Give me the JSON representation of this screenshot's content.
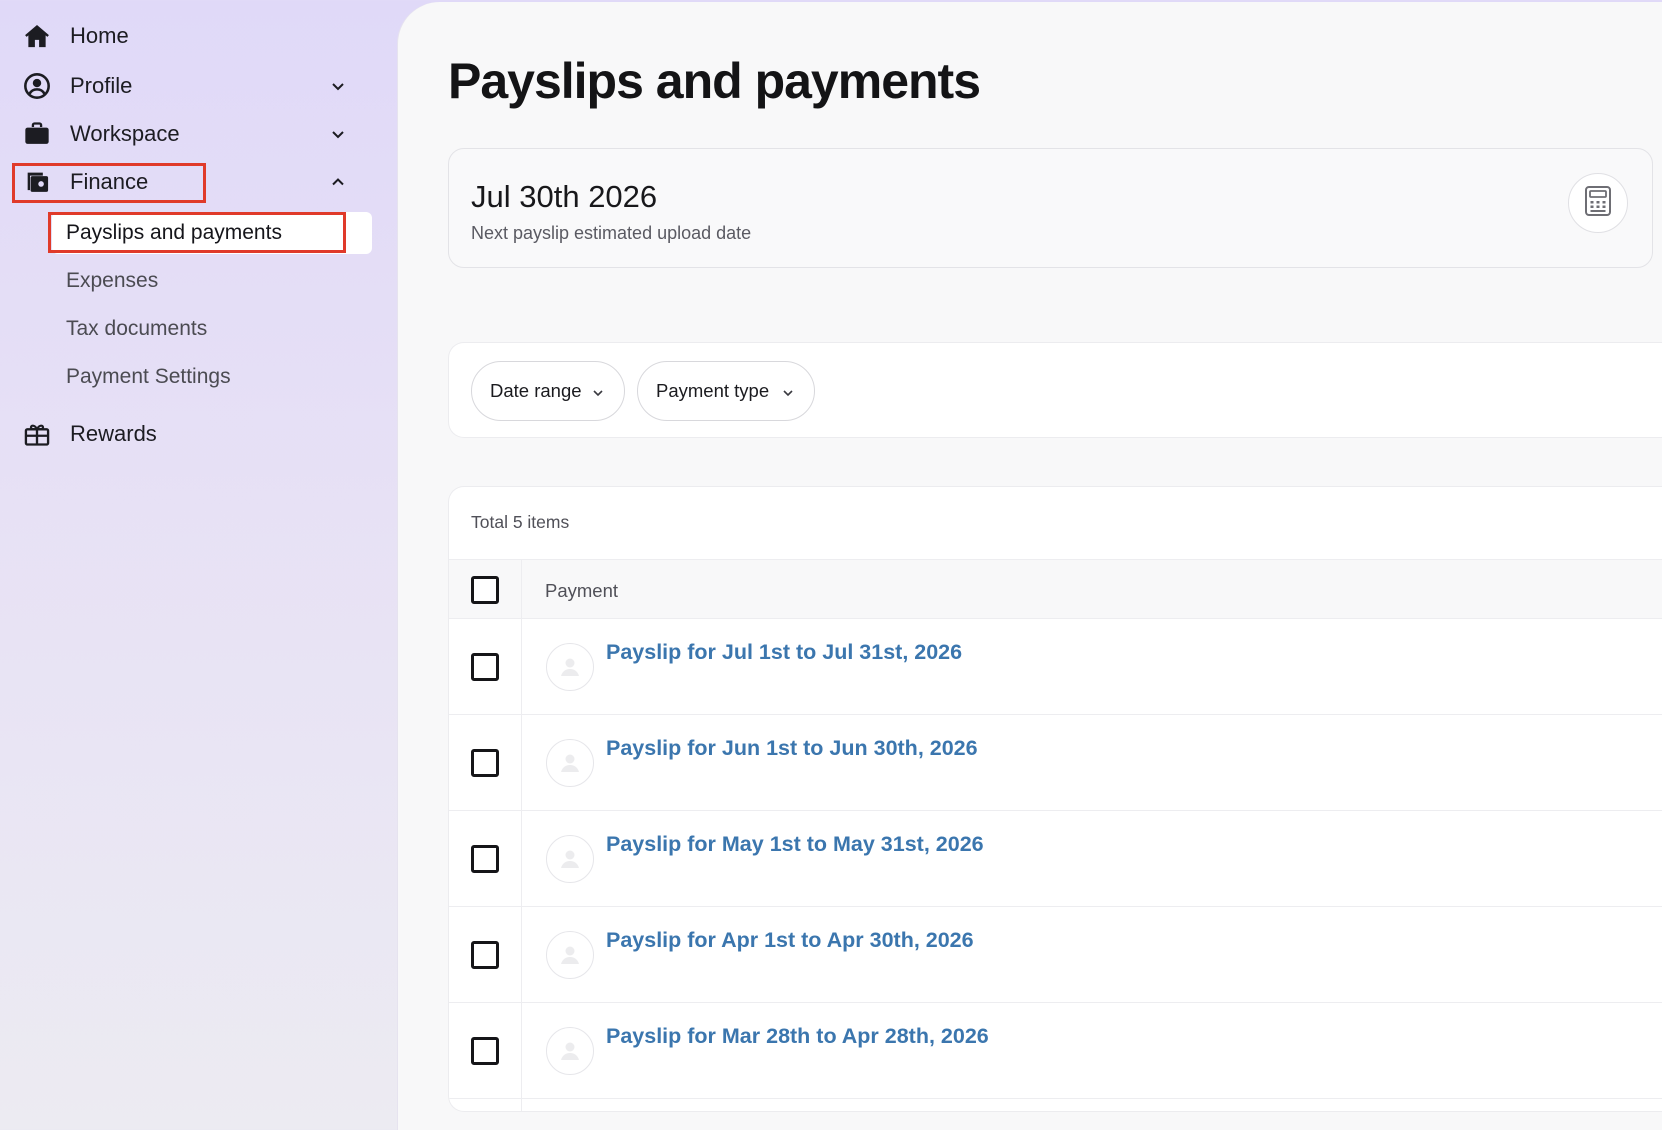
{
  "sidebar": {
    "items": [
      {
        "label": "Home",
        "icon": "home-icon"
      },
      {
        "label": "Profile",
        "icon": "user-circle-icon",
        "expanded": false
      },
      {
        "label": "Workspace",
        "icon": "briefcase-icon",
        "expanded": false
      },
      {
        "label": "Finance",
        "icon": "wallet-icon",
        "expanded": true
      },
      {
        "label": "Rewards",
        "icon": "gift-icon"
      }
    ],
    "finance_subitems": [
      {
        "label": "Payslips and payments",
        "active": true
      },
      {
        "label": "Expenses",
        "active": false
      },
      {
        "label": "Tax documents",
        "active": false
      },
      {
        "label": "Payment Settings",
        "active": false
      }
    ]
  },
  "main": {
    "title": "Payslips and payments",
    "next_payslip": {
      "date": "Jul 30th 2026",
      "caption": "Next payslip estimated upload date",
      "icon": "calculator-icon"
    },
    "filters": [
      "Date range",
      "Payment type"
    ],
    "table": {
      "total_label": "Total 5 items",
      "column_header": "Payment",
      "rows": [
        "Payslip for Jul 1st to Jul 31st, 2026",
        "Payslip for Jun 1st to Jun 30th, 2026",
        "Payslip for May 1st to May 31st, 2026",
        "Payslip for Apr 1st to Apr 30th, 2026",
        "Payslip for Mar 28th to Apr 28th, 2026"
      ]
    }
  },
  "colors": {
    "accent_link": "#3b76ae",
    "highlight": "#e03a2a",
    "sidebar_bg": "#e0d9f8"
  }
}
